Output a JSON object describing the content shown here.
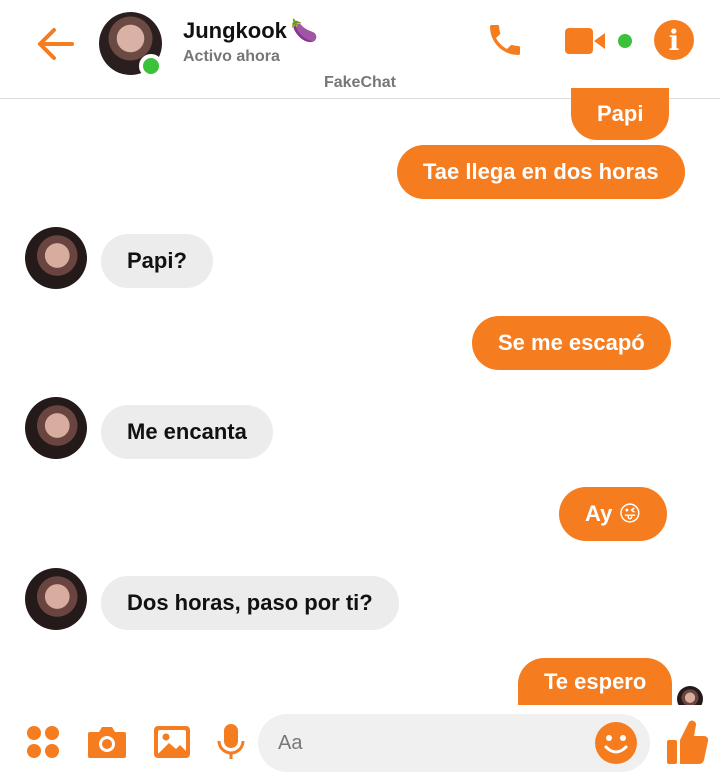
{
  "header": {
    "contact_name": "Jungkook",
    "contact_emoji": "🍆",
    "status": "Activo ahora",
    "app_name": "FakeChat"
  },
  "messages": [
    {
      "side": "out",
      "text": "Papi"
    },
    {
      "side": "out",
      "text": "Tae llega en dos horas"
    },
    {
      "side": "in",
      "text": "Papi?"
    },
    {
      "side": "out",
      "text": "Se me escapó"
    },
    {
      "side": "in",
      "text": "Me encanta"
    },
    {
      "side": "out",
      "text": "Ay",
      "emoji": "😜"
    },
    {
      "side": "in",
      "text": "Dos horas, paso por ti?"
    },
    {
      "side": "out",
      "text": "Te espero"
    }
  ],
  "composer": {
    "placeholder": "Aa"
  },
  "colors": {
    "accent": "#f57c1f",
    "incoming_bubble": "#ececec",
    "online": "#3cc13b"
  },
  "icons": [
    "back-arrow-icon",
    "phone-icon",
    "video-camera-icon",
    "info-icon",
    "apps-grid-icon",
    "camera-icon",
    "image-icon",
    "microphone-icon",
    "smiley-icon",
    "thumbs-up-icon"
  ]
}
